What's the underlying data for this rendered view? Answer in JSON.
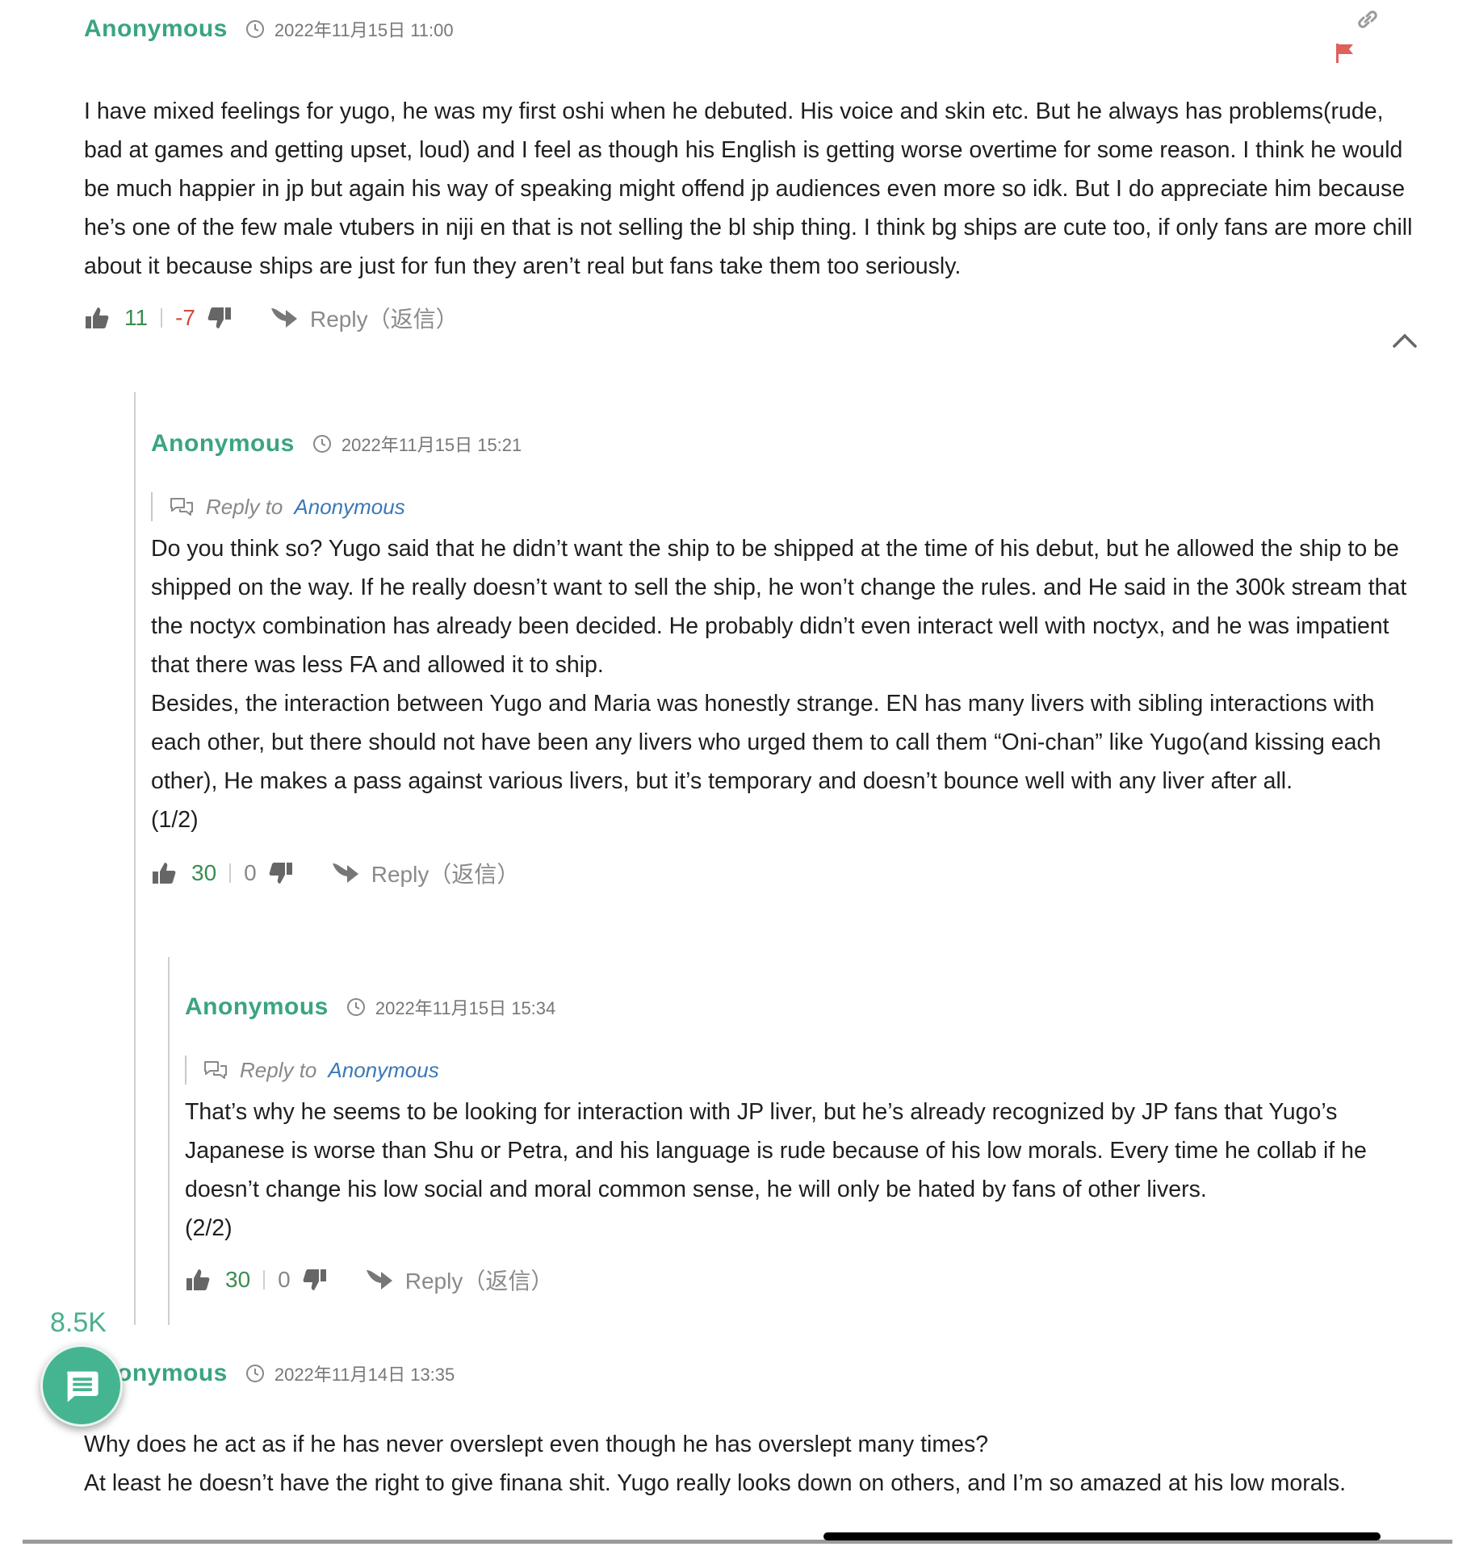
{
  "comments": [
    {
      "author": "Anonymous",
      "date": "2022年11月15日 11:00",
      "paragraphs": [
        "I have mixed feelings for yugo, he was my first oshi when he debuted. His voice and skin etc. But he always has problems(rude, bad at games and getting upset, loud) and I feel as though his English is getting worse overtime for some reason. I think he would be much happier in jp but again his way of speaking might offend jp audiences even more so idk. But I do appreciate him because he’s one of the few male vtubers in niji en that is not selling the bl ship thing. I think bg ships are cute too, if only fans are more chill about it because ships are just for fun they aren’t real but fans take them too seriously."
      ],
      "likes": "11",
      "dislikes": "-7",
      "reply_label": "Reply（返信）"
    },
    {
      "author": "Anonymous",
      "date": "2022年11月15日 15:21",
      "reply_to_label": "Reply to",
      "reply_to_target": "Anonymous",
      "paragraphs": [
        "Do you think so? Yugo said that he didn’t want the ship to be shipped at the time of his debut, but he allowed the ship to be shipped on the way. If he really doesn’t want to sell the ship, he won’t change the rules. and He said in the 300k stream that the noctyx combination has already been decided. He probably didn’t even interact well with noctyx, and he was impatient that there was less FA and allowed it to ship.",
        "Besides, the interaction between Yugo and Maria was honestly strange. EN has many livers with sibling interactions with each other, but there should not have been any livers who urged them to call them “Oni-chan” like Yugo(and kissing each other), He makes a pass against various livers, but it’s temporary and doesn’t bounce well with any liver after all.",
        "(1/2)"
      ],
      "likes": "30",
      "dislikes": "0",
      "reply_label": "Reply（返信）"
    },
    {
      "author": "Anonymous",
      "date": "2022年11月15日 15:34",
      "reply_to_label": "Reply to",
      "reply_to_target": "Anonymous",
      "paragraphs": [
        "That’s why he seems to be looking for interaction with JP liver, but he’s already recognized by JP fans that Yugo’s Japanese is worse than Shu or Petra, and his language is rude because of his low morals. Every time he collab if he doesn’t change his low social and moral common sense, he will only be hated by fans of other livers.",
        "(2/2)"
      ],
      "likes": "30",
      "dislikes": "0",
      "reply_label": "Reply（返信）"
    },
    {
      "author": "Anonymous",
      "date": "2022年11月14日 13:35",
      "paragraphs": [
        "Why does he act as if he has never overslept even though he has overslept many times?",
        "At least he doesn’t have the right to give finana shit. Yugo really looks down on others, and I’m so amazed at his low morals."
      ]
    }
  ],
  "fab": {
    "count": "8.5K",
    "icon": "comment-bubble-icon"
  },
  "colors": {
    "author": "#3aa57f",
    "link": "#3b78b7",
    "upvote": "#3a8d4f",
    "downvote": "#d24a3b",
    "flag": "#e0605a",
    "fab": "#45b591"
  }
}
